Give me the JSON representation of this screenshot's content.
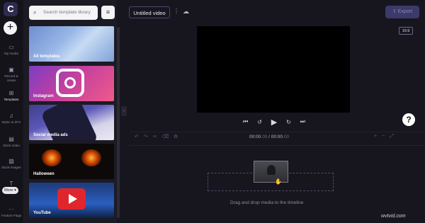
{
  "app": {
    "logo_letter": "C"
  },
  "sidebar": {
    "create_icon": "plus-icon",
    "items": [
      {
        "label": "My media",
        "icon": "folder-icon"
      },
      {
        "label": "Record & create",
        "icon": "video-camera-icon"
      },
      {
        "label": "Templates",
        "icon": "grid-icon"
      },
      {
        "label": "Music & SFX",
        "icon": "music-note-icon"
      },
      {
        "label": "Stock video",
        "icon": "film-icon"
      },
      {
        "label": "Stock images",
        "icon": "image-icon"
      },
      {
        "label": "Text",
        "icon": "text-icon"
      },
      {
        "label": "Feature Flags",
        "icon": "more-dots-icon"
      }
    ],
    "more_label": "More",
    "active_item": "Templates"
  },
  "templates": {
    "search_placeholder": "Search template library",
    "cards": [
      {
        "label": "All templates"
      },
      {
        "label": "Instagram"
      },
      {
        "label": "Social media ads"
      },
      {
        "label": "Halloween"
      },
      {
        "label": "YouTube"
      }
    ]
  },
  "header": {
    "project_title": "Untitled video",
    "export_label": "Export"
  },
  "preview": {
    "aspect_ratio": "16:9",
    "help_label": "?"
  },
  "timeline": {
    "current_time": "00:00",
    "current_frames": ".00",
    "separator": " / ",
    "total_time": "00:00",
    "total_frames": ".00",
    "drop_hint": "Drag and drop media to the timeline"
  },
  "watermark": "wvtvid.com",
  "colors": {
    "background": "#17161f",
    "accent": "#3c3a6a",
    "panel": "#1c1b24"
  }
}
